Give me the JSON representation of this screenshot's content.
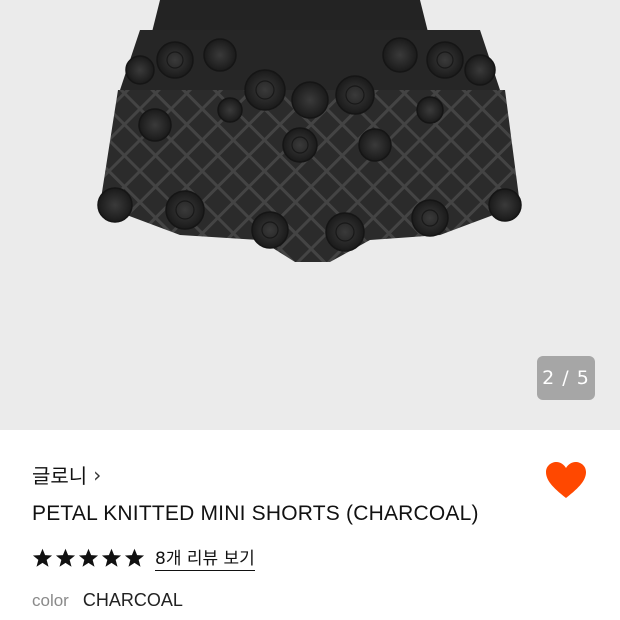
{
  "gallery": {
    "counter": "2 / 5"
  },
  "product": {
    "brand": "글로니",
    "brand_chevron": "›",
    "title": "PETAL KNITTED MINI SHORTS (CHARCOAL)",
    "rating": 5,
    "rating_max": 5,
    "review_link": "8개 리뷰 보기",
    "color_label": "color",
    "color_value": "CHARCOAL",
    "wishlisted": true
  },
  "colors": {
    "gallery_bg": "#ebebeb",
    "heart": "#ff4800",
    "star": "#111111",
    "garment": "#2a2a2a"
  },
  "icons": [
    "heart-icon",
    "star-icon",
    "chevron-right-icon"
  ]
}
